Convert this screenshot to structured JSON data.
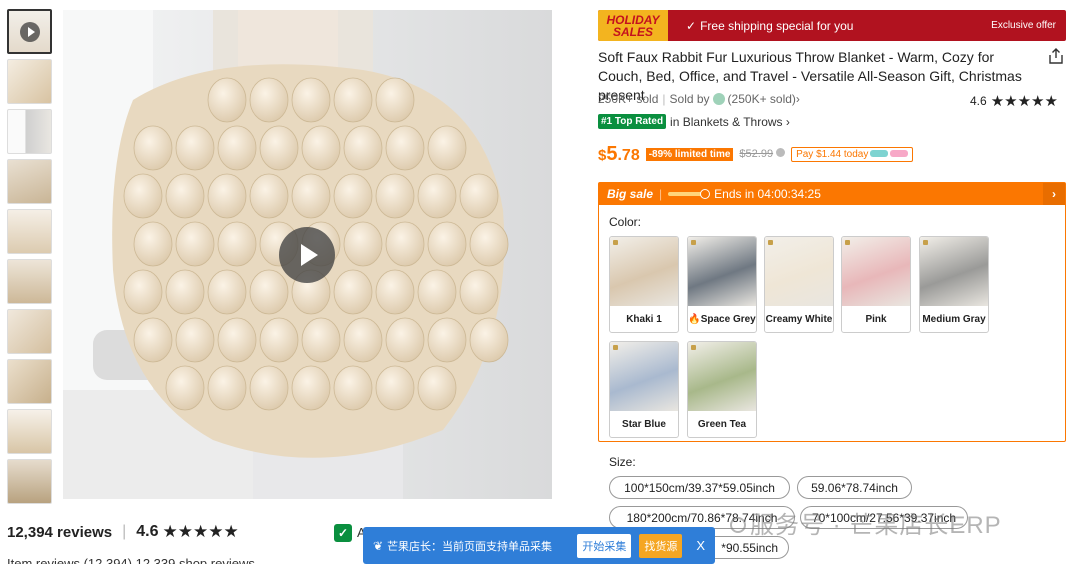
{
  "reviews": {
    "count_label": "12,394 reviews",
    "score": "4.6",
    "stars": "★★★★★",
    "sub_text": "Item reviews (12,394)    12,339 shop reviews"
  },
  "banner": {
    "holiday": "HOLIDAY SALES",
    "free_shipping": "Free shipping special for you",
    "exclusive": "Exclusive offer"
  },
  "product": {
    "title": "Soft Faux Rabbit Fur Luxurious Throw Blanket - Warm, Cozy for Couch, Bed, Office, and Travel - Versatile All-Season Gift, Christmas present",
    "sold": "250K+ sold",
    "sold_by": "Sold by",
    "store_sold": "(250K+ sold)",
    "rating": "4.6",
    "stars": "★★★★★",
    "top_rated_badge": "#1 Top Rated",
    "top_rated_category": "in Blankets & Throws ›",
    "price_currency": "$",
    "price_int": "5",
    "price_cents": ".78",
    "discount": "-89% limited time",
    "old_price": "$52.99",
    "pay_today": "Pay $1.44 today"
  },
  "sale": {
    "label": "Big sale",
    "ends": "Ends in 04:00:34:25",
    "arrow": "›"
  },
  "colors": {
    "label": "Color:",
    "options": [
      "Khaki 1",
      "Space Grey",
      "Creamy White",
      "Pink",
      "Medium Gray",
      "Star Blue",
      "Green Tea"
    ],
    "swatch_colors": [
      "#d9c7ae",
      "#6f7882",
      "#efe6d6",
      "#e8b7b9",
      "#9a9a98",
      "#a9b9cf",
      "#a8b88a"
    ]
  },
  "sizes": {
    "label": "Size:",
    "options": [
      "100*150cm/39.37*59.05inch",
      "59.06*78.74inch",
      "180*200cm/70.86*78.74inch",
      "70*100cm/27.56*39.37inch",
      "*90.55inch"
    ]
  },
  "erp": {
    "message": "芒果店长：当前页面支持单品采集",
    "start_button": "开始采集",
    "find_button": "找货源",
    "close": "X"
  },
  "watermark": "服务号 · 芒果店长ERP"
}
